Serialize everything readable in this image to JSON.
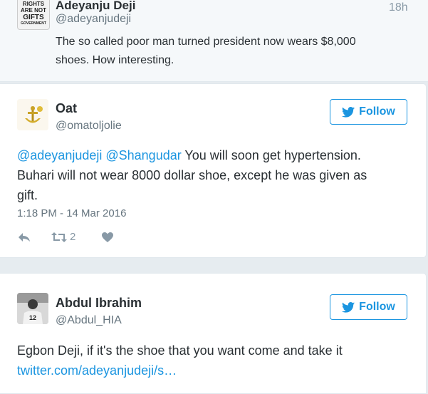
{
  "context_tweet": {
    "avatar_text": [
      "RIGHTS",
      "ARE NOT",
      "GIFTS",
      "GOVERNMENT"
    ],
    "name": "Adeyanju Deji",
    "handle": "@adeyanjudeji",
    "time_ago": "18h",
    "text_line1": "The so called poor man turned president now wears $8,000",
    "text_line2": "shoes. How interesting."
  },
  "tweet1": {
    "name": "Oat",
    "handle": "@omatoljolie",
    "follow_label": "Follow",
    "mention1": "@adeyanjudeji",
    "mention2": "@Shangudar",
    "line1_rest": " You will soon get hypertension.",
    "line2": "Buhari will not wear 8000 dollar shoe, except he was given as",
    "line3": "gift.",
    "timestamp": "1:18 PM - 14 Mar 2016",
    "retweet_count": "2"
  },
  "tweet2": {
    "name": "Abdul Ibrahim",
    "handle": "@Abdul_HIA",
    "follow_label": "Follow",
    "line1": "Egbon Deji, if it's the shoe that you want come and take it",
    "link": "twitter.com/adeyanjudeji/s…"
  },
  "colors": {
    "accent": "#1b95e0",
    "text": "#292f33",
    "muted": "#66757f",
    "top_bar": "#1aa15f"
  },
  "icons": [
    "twitter-bird-icon",
    "reply-icon",
    "retweet-icon",
    "like-icon"
  ]
}
